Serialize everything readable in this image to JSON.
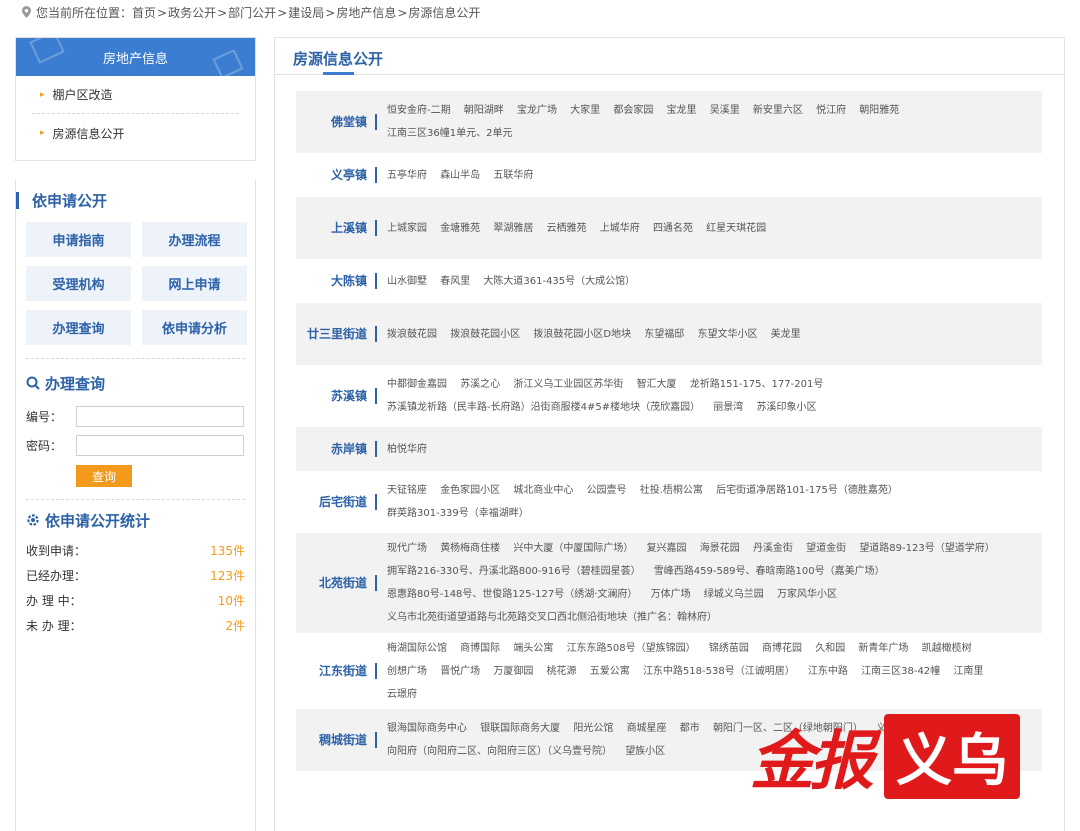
{
  "breadcrumb": {
    "prefix": "您当前所在位置：",
    "items": [
      "首页",
      "政务公开",
      "部门公开",
      "建设局",
      "房地产信息",
      "房源信息公开"
    ],
    "sep": ">"
  },
  "left_nav": {
    "title": "房地产信息",
    "items": [
      "棚户区改造",
      "房源信息公开"
    ]
  },
  "apply": {
    "title": "依申请公开",
    "buttons": [
      "申请指南",
      "办理流程",
      "受理机构",
      "网上申请",
      "办理查询",
      "依申请分析"
    ]
  },
  "query": {
    "title": "办理查询",
    "id_label": "编号：",
    "pwd_label": "密码：",
    "submit": "查询"
  },
  "stats": {
    "title": "依申请公开统计",
    "rows": [
      {
        "label": "收到申请：",
        "value": "135件"
      },
      {
        "label": "已经办理：",
        "value": "123件"
      },
      {
        "label": "办 理 中：",
        "value": "10件"
      },
      {
        "label": "未 办 理：",
        "value": "2件"
      }
    ]
  },
  "main": {
    "title": "房源信息公开",
    "rows": [
      {
        "town": "佛堂镇",
        "items": [
          "恒安金府-二期",
          "朝阳湖畔",
          "宝龙广场",
          "大家里",
          "都会家园",
          "宝龙里",
          "吴溪里",
          "新安里六区",
          "悦江府",
          "朝阳雅苑",
          "江南三区36幢1单元、2单元"
        ]
      },
      {
        "town": "义亭镇",
        "items": [
          "五亭华府",
          "森山半岛",
          "五联华府"
        ]
      },
      {
        "town": "上溪镇",
        "items": [
          "上城家园",
          "金塘雅苑",
          "翠湖雅居",
          "云栖雅苑",
          "上城华府",
          "四通名苑",
          "红星天琪花园"
        ]
      },
      {
        "town": "大陈镇",
        "items": [
          "山水御墅",
          "春风里",
          "大陈大道361-435号（大成公馆）"
        ]
      },
      {
        "town": "廿三里街道",
        "items": [
          "拨浪鼓花园",
          "拨浪鼓花园小区",
          "拨浪鼓花园小区D地块",
          "东望福邸",
          "东望文华小区",
          "美龙里"
        ]
      },
      {
        "town": "苏溪镇",
        "items": [
          "中都御金嘉园",
          "苏溪之心",
          "浙江义乌工业园区苏华街",
          "智汇大厦",
          "龙祈路151-175、177-201号",
          "苏溪镇龙祈路（民丰路-长府路）沿街商服楼4#5#楼地块（茂欣嘉园）",
          "丽景湾",
          "苏溪印象小区"
        ]
      },
      {
        "town": "赤岸镇",
        "items": [
          "柏悦华府"
        ]
      },
      {
        "town": "后宅街道",
        "items": [
          "天钲铭座",
          "金色家园小区",
          "城北商业中心",
          "公园壹号",
          "社投.梧桐公寓",
          "后宅街道净居路101-175号（德胜嘉苑）",
          "群英路301-339号（幸福湖畔）"
        ]
      },
      {
        "town": "北苑街道",
        "items": [
          "现代广场",
          "黄杨梅商住楼",
          "兴中大厦（中厦国际广场）",
          "复兴嘉园",
          "海景花园",
          "丹溪金街",
          "望道金街",
          "望道路89-123号（望道学府）",
          "拥军路216-330号、丹溪北路800-916号（碧桂园星荟）",
          "雪峰西路459-589号、春晗南路100号（嘉美广场）",
          "恩惠路80号-148号、世俊路125-127号（绣湖·文澜府）",
          "万体广场",
          "绿城义乌兰园",
          "万家风华小区",
          "义乌市北苑街道望道路与北苑路交叉口西北侧沿街地块（推广名：翰林府）"
        ]
      },
      {
        "town": "江东街道",
        "items": [
          "梅湖国际公馆",
          "商博国际",
          "端头公寓",
          "江东东路508号（望族锦园）",
          "锦绣苗园",
          "商博花园",
          "久和园",
          "新青年广场",
          "凯越橄榄树",
          "创想广场",
          "晋悦广场",
          "万厦御园",
          "桃花源",
          "五爱公寓",
          "江东中路518-538号（江诚明居）",
          "江东中路",
          "江南三区38-42幢",
          "江南里",
          "云璟府"
        ]
      },
      {
        "town": "稠城街道",
        "items": [
          "银海国际商务中心",
          "银联国际商务大厦",
          "阳光公馆",
          "商城星座",
          "都市",
          "朝阳门一区、二区（绿地朝阳门）",
          "义乌壹号院",
          "向阳府（向阳府二区、向阳府三区）（义乌壹号院）",
          "望族小区"
        ]
      }
    ]
  },
  "watermark": {
    "brand": "金报",
    "city": "义乌"
  }
}
